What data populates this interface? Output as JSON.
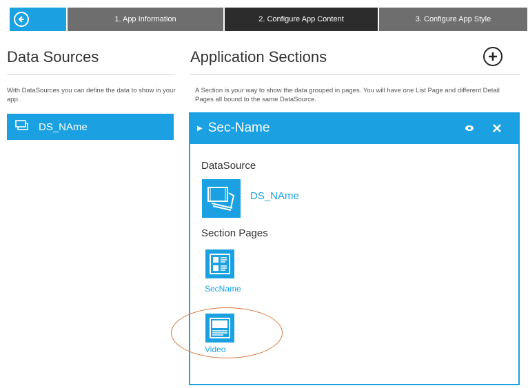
{
  "wizard": {
    "steps": [
      "1. App Information",
      "2. Configure App Content",
      "3. Configure App Style"
    ],
    "active_step": 2
  },
  "data_sources": {
    "title": "Data Sources",
    "description": "With DataSources you can define the data to show in your app.",
    "items": [
      {
        "label": "DS_NAme",
        "icon": "datasource-icon"
      }
    ]
  },
  "application_sections": {
    "title": "Application Sections",
    "description": "A Section is your way to show the data grouped in pages. You will have one List Page and different Detail Pages all bound to the same DataSource.",
    "add_icon": "add-circle-icon"
  },
  "section": {
    "name": "Sec-Name",
    "datasource_heading": "DataSource",
    "datasource_name": "DS_NAme",
    "pages_heading": "Section Pages",
    "pages": [
      {
        "label": "SecName",
        "icon": "list-page-icon"
      },
      {
        "label": "Video",
        "icon": "detail-page-icon"
      }
    ]
  },
  "colors": {
    "accent": "#1ba1e2",
    "step_inactive": "#6e6e6e",
    "step_active": "#2c2c2c",
    "highlight": "#d8773e"
  }
}
